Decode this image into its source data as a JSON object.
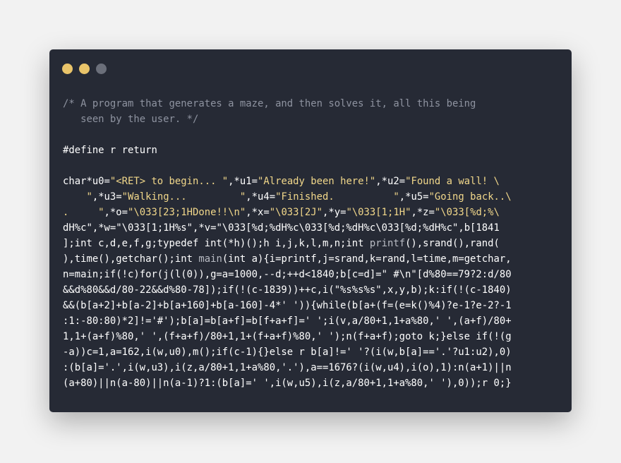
{
  "window": {
    "controls": [
      {
        "name": "close",
        "color": "#e9c46a"
      },
      {
        "name": "minimize",
        "color": "#e9c46a"
      },
      {
        "name": "maximize",
        "color": "#6b6f7a"
      }
    ]
  },
  "code": {
    "lines": [
      [
        {
          "t": "/* A program that generates a maze, and then solves it, all this being",
          "c": "cm"
        }
      ],
      [
        {
          "t": "   seen by the user. */",
          "c": "cm"
        }
      ],
      [
        {
          "t": "",
          "c": "kw"
        }
      ],
      [
        {
          "t": "#define r return",
          "c": "kw"
        }
      ],
      [
        {
          "t": "",
          "c": "kw"
        }
      ],
      [
        {
          "t": "char*u0=",
          "c": "kw"
        },
        {
          "t": "\"<RET> to begin... \"",
          "c": "str"
        },
        {
          "t": ",*u1=",
          "c": "kw"
        },
        {
          "t": "\"Already been here!\"",
          "c": "str"
        },
        {
          "t": ",*u2=",
          "c": "kw"
        },
        {
          "t": "\"Found a wall! \\",
          "c": "str"
        }
      ],
      [
        {
          "t": "    \"",
          "c": "str"
        },
        {
          "t": ",*u3=",
          "c": "kw"
        },
        {
          "t": "\"Walking...         \"",
          "c": "str"
        },
        {
          "t": ",*u4=",
          "c": "kw"
        },
        {
          "t": "\"Finished.          \"",
          "c": "str"
        },
        {
          "t": ",*u5=",
          "c": "kw"
        },
        {
          "t": "\"Going back..\\",
          "c": "str"
        }
      ],
      [
        {
          "t": ".     \"",
          "c": "str"
        },
        {
          "t": ",*o=",
          "c": "kw"
        },
        {
          "t": "\"\\033[23;1HDone!!\\n\"",
          "c": "str"
        },
        {
          "t": ",*x=",
          "c": "kw"
        },
        {
          "t": "\"\\033[2J\"",
          "c": "str"
        },
        {
          "t": ",*y=",
          "c": "kw"
        },
        {
          "t": "\"\\033[1;1H\"",
          "c": "str"
        },
        {
          "t": ",*z=",
          "c": "kw"
        },
        {
          "t": "\"\\033[%d;%\\",
          "c": "str"
        }
      ],
      [
        {
          "t": "dH%c\"",
          "c": "kw"
        },
        {
          "t": ",*w=\"\\033[1;1H%s\",*v=\"\\033[%d;%dH%c\\033[%d;%dH%c\\033[%d;%dH%c\",b[1841",
          "c": "kw"
        }
      ],
      [
        {
          "t": "];int c,d,e,f,g;typedef int(*h)();h i,j,k,l,m,n;int ",
          "c": "kw"
        },
        {
          "t": "printf",
          "c": "fn"
        },
        {
          "t": "(),srand(),rand(",
          "c": "kw"
        }
      ],
      [
        {
          "t": "),time(),getchar();int ",
          "c": "kw"
        },
        {
          "t": "main",
          "c": "fn"
        },
        {
          "t": "(int a){i=printf,j=srand,k=rand,l=time,m=getchar,",
          "c": "kw"
        }
      ],
      [
        {
          "t": "n=main;if(!c)for(j(l(0)),g=a=1000,--d;++d<1840;b[c=d]=\" #\\n\"[d%80==79?2:d/80",
          "c": "kw"
        }
      ],
      [
        {
          "t": "&&d%80&&d/80-22&&d%80-78]);if(!(c-1839))++c,i(\"%s%s%s\",x,y,b);k:if(!(c-1840)",
          "c": "kw"
        }
      ],
      [
        {
          "t": "&&(b[a+2]+b[a-2]+b[a+160]+b[a-160]-4*' ')){while(b[a+(f=(e=k()%4)?e-1?e-2?-1",
          "c": "kw"
        }
      ],
      [
        {
          "t": ":1:-80:80)*2]!='#');b[a]=b[a+f]=b[f+a+f]=' ';i(v,a/80+1,1+a%80,' ',(a+f)/80+",
          "c": "kw"
        }
      ],
      [
        {
          "t": "1,1+(a+f)%80,' ',(f+a+f)/80+1,1+(f+a+f)%80,' ');n(f+a+f);goto k;}else if(!(g",
          "c": "kw"
        }
      ],
      [
        {
          "t": "-a))c=1,a=162,i(w,u0),m();if(c-1){}else r b[a]!=' '?(i(w,b[a]=='.'?u1:u2),0)",
          "c": "kw"
        }
      ],
      [
        {
          "t": ":(b[a]='.',i(w,u3),i(z,a/80+1,1+a%80,'.'),a==1676?(i(w,u4),i(o),1):n(a+1)||n",
          "c": "kw"
        }
      ],
      [
        {
          "t": "(a+80)||n(a-80)||n(a-1)?1:(b[a]=' ',i(w,u5),i(z,a/80+1,1+a%80,' '),0));r 0;}",
          "c": "kw"
        }
      ]
    ]
  }
}
